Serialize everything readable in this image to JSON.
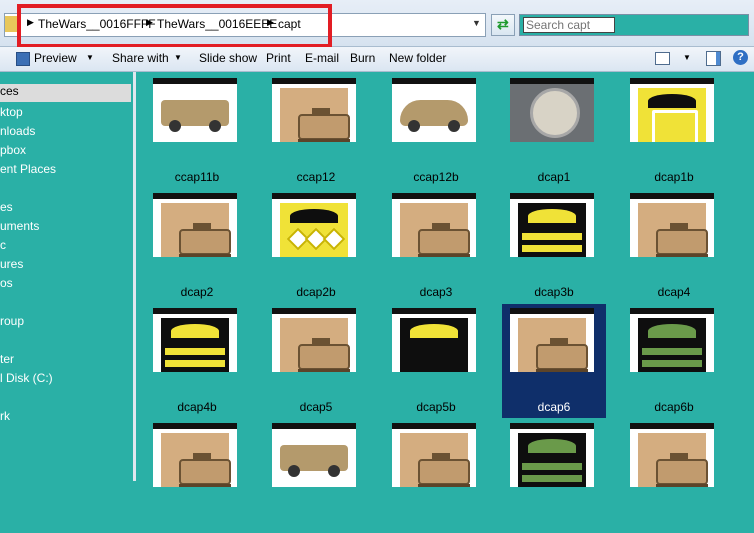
{
  "address": {
    "crumbs": [
      "TheWars__0016FFFF",
      "TheWars__0016EEEE",
      "capt"
    ]
  },
  "search": {
    "placeholder": "Search capt"
  },
  "toolbar": {
    "preview": "Preview",
    "share_with": "Share with",
    "slide_show": "Slide show",
    "print": "Print",
    "email": "E-mail",
    "burn": "Burn",
    "new_folder": "New folder"
  },
  "nav": {
    "items": [
      "ces",
      "ktop",
      "nloads",
      "pbox",
      "ent Places",
      "es",
      "uments",
      "c",
      "ures",
      "os",
      "roup",
      "ter",
      "l Disk (C:)",
      "rk"
    ]
  },
  "files": [
    {
      "name": "ccap11b",
      "kind": "photo-truck"
    },
    {
      "name": "ccap12",
      "kind": "tan-tank"
    },
    {
      "name": "ccap12b",
      "kind": "photo-car"
    },
    {
      "name": "dcap1",
      "kind": "photo-watch"
    },
    {
      "name": "dcap1b",
      "kind": "patch-cross"
    },
    {
      "name": "dcap2",
      "kind": "tan-tank"
    },
    {
      "name": "dcap2b",
      "kind": "patch-diamonds"
    },
    {
      "name": "dcap3",
      "kind": "tan-tank"
    },
    {
      "name": "dcap3b",
      "kind": "patch-stripes"
    },
    {
      "name": "dcap4",
      "kind": "tan-tank"
    },
    {
      "name": "dcap4b",
      "kind": "patch-stripes"
    },
    {
      "name": "dcap5",
      "kind": "tan-tank"
    },
    {
      "name": "dcap5b",
      "kind": "patch-wreath"
    },
    {
      "name": "dcap6",
      "kind": "tan-tank",
      "selected": true
    },
    {
      "name": "dcap6b",
      "kind": "patch-green"
    },
    {
      "name": "",
      "kind": "tan-tank"
    },
    {
      "name": "",
      "kind": "photo-tank"
    },
    {
      "name": "",
      "kind": "tan-tank"
    },
    {
      "name": "",
      "kind": "patch-green"
    },
    {
      "name": "",
      "kind": "tan-tank"
    }
  ],
  "colors": {
    "background": "#2ab0a6",
    "highlight_box": "#e21d24",
    "selection": "#0f2f6a",
    "patch_yellow": "#f0e237",
    "tan": "#d4ad80"
  }
}
